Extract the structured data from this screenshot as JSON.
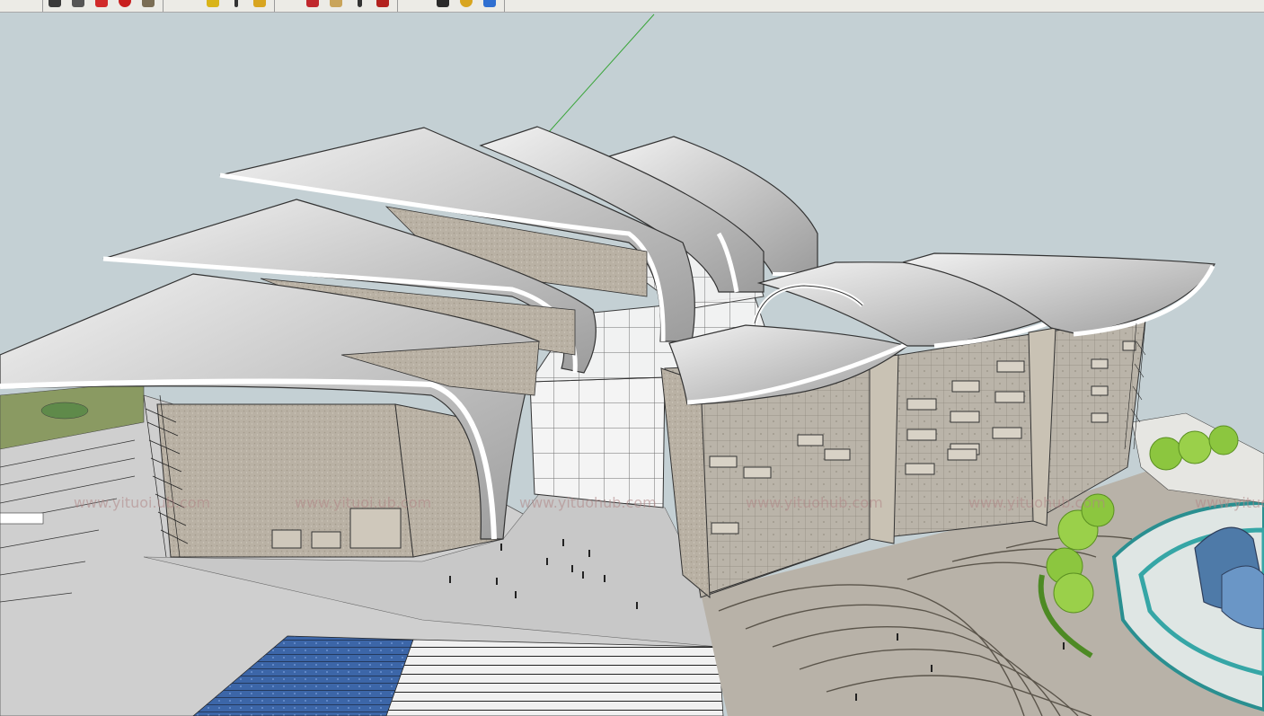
{
  "app": {
    "toolbar": {
      "groups": [
        {
          "name": "main-tools",
          "buttons": [
            {
              "icon": "dark-tool-icon",
              "color": "#3a3a3a"
            },
            {
              "icon": "eraser-icon",
              "color": "#555555"
            },
            {
              "icon": "pencil-red-icon",
              "color": "#d12a2a"
            },
            {
              "icon": "rotate-red-icon",
              "color": "#c81f1f"
            },
            {
              "icon": "paint-bucket-icon",
              "color": "#7a6d55"
            }
          ]
        },
        {
          "name": "draw-tools",
          "buttons": [
            {
              "icon": "pencil-yellow-icon",
              "color": "#d9b418"
            },
            {
              "icon": "dimension-icon",
              "color": "#333333"
            },
            {
              "icon": "tape-measure-icon",
              "color": "#d8a520"
            }
          ]
        },
        {
          "name": "camera-tools",
          "buttons": [
            {
              "icon": "orbit-red-icon",
              "color": "#c0272d"
            },
            {
              "icon": "hand-pan-icon",
              "color": "#c9a45a"
            },
            {
              "icon": "zoom-icon",
              "color": "#333333"
            },
            {
              "icon": "walk-icon",
              "color": "#b3221f"
            }
          ]
        },
        {
          "name": "view-tools",
          "buttons": [
            {
              "icon": "previous-view-icon",
              "color": "#2a2a2a"
            },
            {
              "icon": "position-camera-icon",
              "color": "#d8a520"
            },
            {
              "icon": "next-view-icon",
              "color": "#2f6fd1"
            }
          ]
        }
      ]
    },
    "viewport": {
      "sky_color": "#c4d0d4",
      "ground_color": "#cfcfcf",
      "watermarks": [
        "www.yituoi.ub.com",
        "www.yituoi.ub.com",
        "www.yituohub.com",
        "www.yituohub.com",
        "www.yituohub.com",
        "www.yituohub.com",
        "www.yi"
      ]
    }
  }
}
